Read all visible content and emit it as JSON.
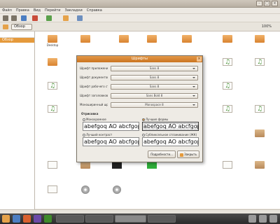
{
  "window": {
    "title": ""
  },
  "menubar": {
    "items": [
      "Файл",
      "Правка",
      "Вид",
      "Перейти",
      "Закладки",
      "Справка"
    ]
  },
  "location": {
    "crumb": "Обзор",
    "zoom": "100%"
  },
  "sidepane": {
    "head": "",
    "items": [
      "Обзор"
    ]
  },
  "files": [
    {
      "icon": "folder-icon",
      "label": "Desktop"
    },
    {
      "icon": "folder-icon",
      "label": ""
    },
    {
      "icon": "folder-icon",
      "label": ""
    },
    {
      "icon": "folder-icon",
      "label": ""
    },
    {
      "icon": "folder-icon",
      "label": ""
    },
    {
      "icon": "folder-icon",
      "label": ""
    },
    {
      "icon": "folder-icon",
      "label": ""
    },
    {
      "icon": "doc-icon",
      "label": ""
    },
    {
      "icon": "music-icon",
      "label": ""
    },
    {
      "icon": "music-icon",
      "label": ""
    },
    {
      "icon": "music-icon",
      "label": ""
    },
    {
      "icon": "music-icon",
      "label": ""
    },
    {
      "icon": "package-icon",
      "label": ""
    },
    {
      "icon": "package-icon",
      "label": ""
    },
    {
      "icon": "image-icon",
      "label": ""
    },
    {
      "icon": "image-icon",
      "label": ""
    },
    {
      "icon": "doc-icon",
      "label": ""
    },
    {
      "icon": "package-icon",
      "label": ""
    },
    {
      "icon": "doc-icon",
      "label": ""
    },
    {
      "icon": "disc-icon",
      "label": ""
    },
    {
      "icon": "disc-icon",
      "label": ""
    },
    {
      "icon": "disc-icon",
      "label": ""
    },
    {
      "icon": "disc-icon",
      "label": ""
    },
    {
      "icon": "disc-icon",
      "label": ""
    },
    {
      "icon": "doc-icon",
      "label": ""
    }
  ],
  "dialog": {
    "title": "Шрифты",
    "rows": [
      {
        "label": "Шрифт приложений:",
        "value": "Sans 8"
      },
      {
        "label": "Шрифт документов:",
        "value": "Sans 8"
      },
      {
        "label": "Шрифт рабочего стола:",
        "value": "Sans 8"
      },
      {
        "label": "Шрифт заголовков окон:",
        "value": "Sans Bold 8"
      },
      {
        "label": "Моноширинный шрифт:",
        "value": "Monospace 8"
      }
    ],
    "section": "Отрисовка",
    "options": [
      {
        "label": "Монохромное",
        "sample": "abefgoq AO abcfgop"
      },
      {
        "label": "Лучшие формы",
        "sample": "abefgoq AO abcfgop"
      },
      {
        "label": "Лучший контраст",
        "sample": "abefgoq AO abcfgop"
      },
      {
        "label": "Субпиксельное сглаживание (ЖК)",
        "sample": "abefgoq AO abcfgop"
      }
    ],
    "buttons": {
      "details": "Подробности...",
      "close": "Закрыть"
    }
  },
  "taskbar": {
    "buttons": [
      "",
      "",
      "",
      ""
    ]
  }
}
